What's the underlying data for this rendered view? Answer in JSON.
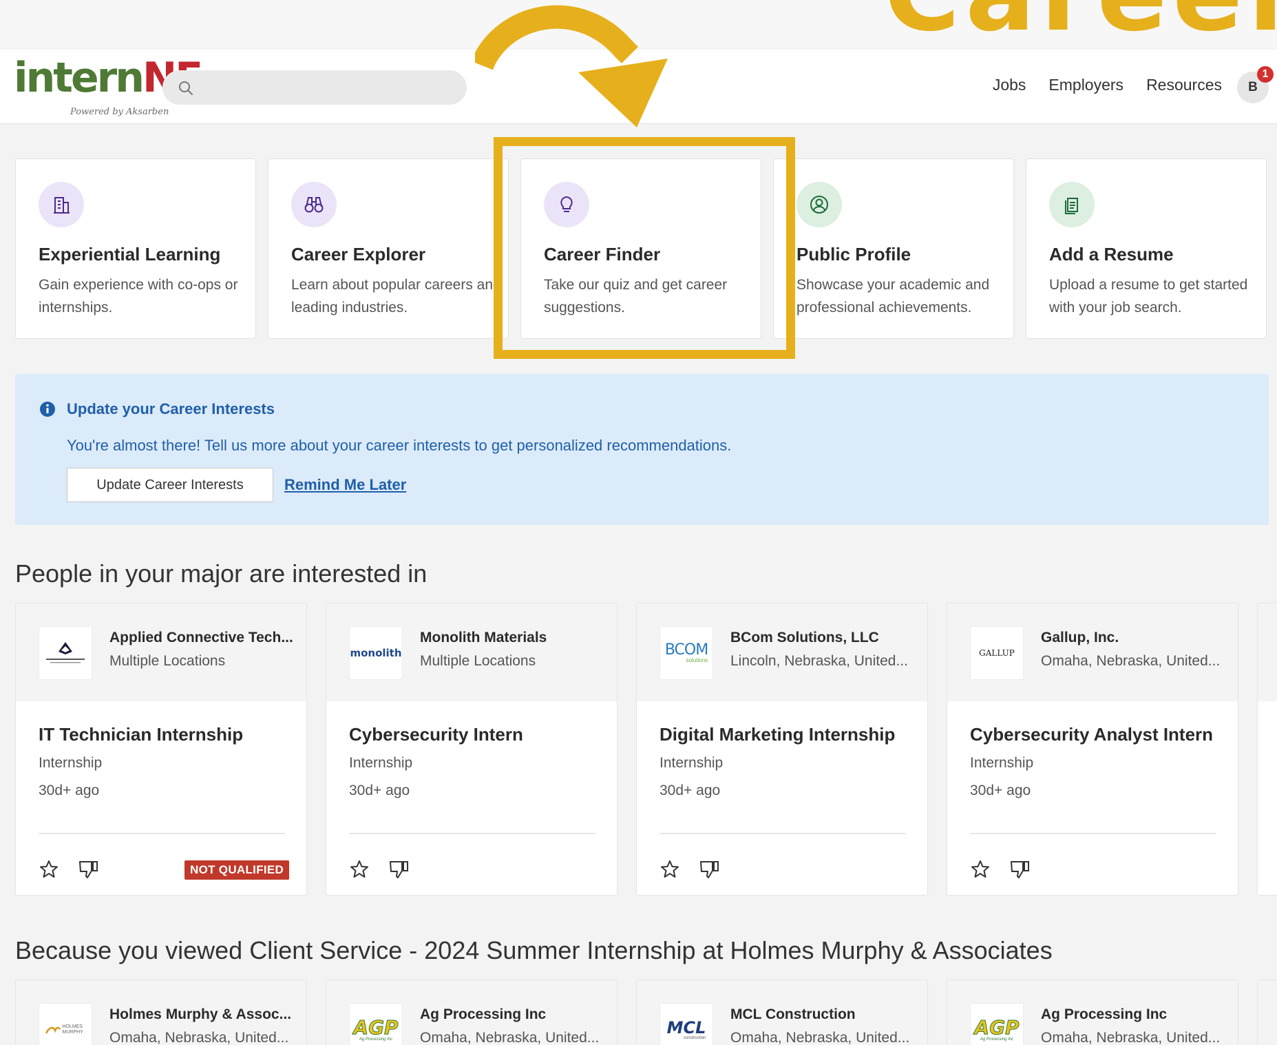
{
  "promo": {
    "text": "Career"
  },
  "header": {
    "logo_main_a": "intern",
    "logo_main_b": "NE",
    "logo_sub": "Powered by Aksarben",
    "search_placeholder": "",
    "nav": [
      "Jobs",
      "Employers",
      "Resources"
    ],
    "avatar_initial": "B",
    "notification_count": "1"
  },
  "features": [
    {
      "icon": "building-icon",
      "title": "Experiential Learning",
      "desc": "Gain experience with co-ops or internships."
    },
    {
      "icon": "binoculars-icon",
      "title": "Career Explorer",
      "desc": "Learn about popular careers and leading industries."
    },
    {
      "icon": "lightbulb-icon",
      "title": "Career Finder",
      "desc": "Take our quiz and get career suggestions."
    },
    {
      "icon": "profile-icon",
      "title": "Public Profile",
      "desc": "Showcase your academic and professional achievements."
    },
    {
      "icon": "document-icon",
      "title": "Add a Resume",
      "desc": "Upload a resume to get started with your job search."
    }
  ],
  "alert": {
    "title": "Update your Career Interests",
    "text": "You're almost there! Tell us more about your career interests to get personalized recommendations.",
    "button": "Update Career Interests",
    "link": "Remind Me Later"
  },
  "section1": {
    "title": "People in your major are interested in",
    "jobs": [
      {
        "company": "Applied Connective Tech...",
        "location": "Multiple Locations",
        "title": "IT Technician Internship",
        "type": "Internship",
        "age": "30d+ ago",
        "badge": "NOT QUALIFIED"
      },
      {
        "company": "Monolith Materials",
        "location": "Multiple Locations",
        "title": "Cybersecurity Intern",
        "type": "Internship",
        "age": "30d+ ago"
      },
      {
        "company": "BCom Solutions, LLC",
        "location": "Lincoln, Nebraska, United...",
        "title": "Digital Marketing Internship",
        "type": "Internship",
        "age": "30d+ ago"
      },
      {
        "company": "Gallup, Inc.",
        "location": "Omaha, Nebraska, United...",
        "title": "Cybersecurity Analyst Intern",
        "type": "Internship",
        "age": "30d+ ago"
      }
    ]
  },
  "section2": {
    "title": "Because you viewed Client Service - 2024 Summer Internship at Holmes Murphy & Associates",
    "jobs": [
      {
        "company": "Holmes Murphy & Assoc...",
        "location": "Omaha, Nebraska, United..."
      },
      {
        "company": "Ag Processing Inc",
        "location": "Omaha, Nebraska, United..."
      },
      {
        "company": "MCL Construction",
        "location": "Omaha, Nebraska, United..."
      },
      {
        "company": "Ag Processing Inc",
        "location": "Omaha, Nebraska, United..."
      }
    ]
  },
  "logos": {
    "monolith": "monolith",
    "bcom": "BCOM",
    "bcom_sub": "solutions",
    "gallup": "GALLUP",
    "holmes": "HOLMES MURPHY",
    "agp": "AGP",
    "agp_sub": "Ag Processing Inc",
    "mcl": "MCL",
    "mcl_sub": "construction"
  },
  "colors": {
    "accent_gold": "#e6b01c",
    "link_blue": "#1f5fa8",
    "alert_bg": "#dcebfa",
    "badge_red": "#c0392b",
    "logo_green": "#4f7a35",
    "logo_red": "#c2272d"
  }
}
